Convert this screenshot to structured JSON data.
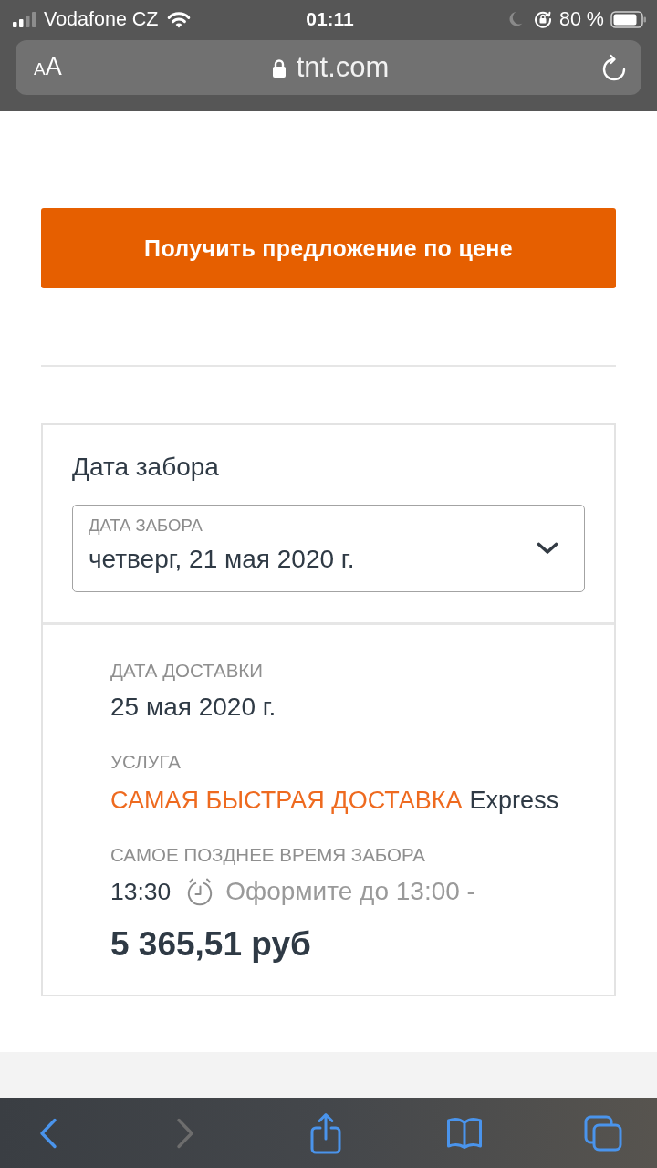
{
  "status_bar": {
    "carrier": "Vodafone CZ",
    "time": "01:11",
    "battery": "80 %"
  },
  "address_bar": {
    "text_size": "AA",
    "url": "tnt.com"
  },
  "quote_button": {
    "label": "Получить предложение по цене"
  },
  "pickup": {
    "title": "Дата забора",
    "date_field": {
      "label": "ДАТА ЗАБОРА",
      "value": "четверг, 21 мая 2020 г."
    }
  },
  "quote": {
    "delivery_date": {
      "label": "ДАТА ДОСТАВКИ",
      "value": "25 мая 2020 г."
    },
    "service": {
      "label": "УСЛУГА",
      "name": "САМАЯ БЫСТРАЯ ДОСТАВКА",
      "product": "Express"
    },
    "latest_pickup": {
      "label": "САМОЕ ПОЗДНЕЕ ВРЕМЯ ЗАБОРА",
      "time": "13:30",
      "note": "Оформите до 13:00 -"
    },
    "price": "5 365,51 руб"
  },
  "toolbar": {
    "buttons": [
      {
        "kind": "back",
        "disabled": false
      },
      {
        "kind": "forward",
        "disabled": true
      },
      {
        "kind": "share",
        "disabled": false
      },
      {
        "kind": "bookmarks",
        "disabled": false
      },
      {
        "kind": "tabs",
        "disabled": false
      }
    ]
  }
}
